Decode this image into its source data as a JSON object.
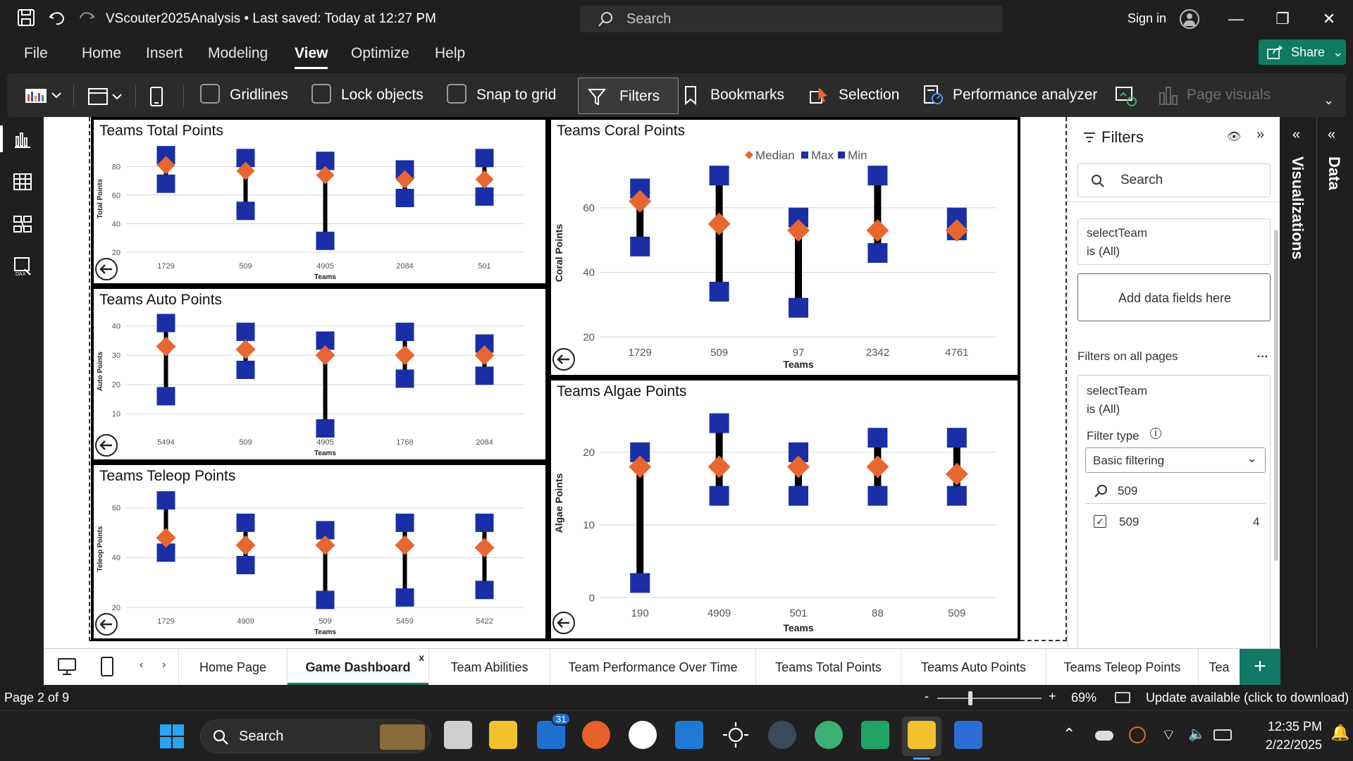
{
  "titlebar": {
    "doc_title": "VScouter2025Analysis • Last saved: Today at 12:27 PM",
    "search_placeholder": "Search",
    "sign_in": "Sign in"
  },
  "menu": {
    "items": [
      "File",
      "Home",
      "Insert",
      "Modeling",
      "View",
      "Optimize",
      "Help"
    ],
    "active": "View",
    "share": "Share"
  },
  "ribbon": {
    "gridlines": "Gridlines",
    "lock_objects": "Lock objects",
    "snap_to_grid": "Snap to grid",
    "filters": "Filters",
    "bookmarks": "Bookmarks",
    "selection": "Selection",
    "performance_analyzer": "Performance analyzer",
    "page_visuals": "Page visuals"
  },
  "colors": {
    "median": "#e8662f",
    "maxmin": "#1a2fa6",
    "bar": "#000000",
    "accent": "#117865"
  },
  "chart_data": [
    {
      "type": "scatter",
      "title": "Teams Total Points",
      "xlabel": "Teams",
      "ylabel": "Total Points",
      "categories": [
        "1729",
        "509",
        "4905",
        "2084",
        "501"
      ],
      "ylim": [
        20,
        95
      ],
      "yticks": [
        20,
        40,
        60,
        80
      ],
      "series": [
        {
          "name": "Median",
          "values": [
            81,
            77,
            74,
            71,
            71
          ]
        },
        {
          "name": "Max",
          "values": [
            88,
            86,
            84,
            78,
            86
          ]
        },
        {
          "name": "Min",
          "values": [
            68,
            49,
            28,
            58,
            59
          ]
        }
      ]
    },
    {
      "type": "scatter",
      "title": "Teams Auto Points",
      "xlabel": "Teams",
      "ylabel": "Auto Points",
      "categories": [
        "5494",
        "509",
        "4905",
        "1768",
        "2084"
      ],
      "ylim": [
        5,
        44
      ],
      "yticks": [
        10,
        20,
        30,
        40
      ],
      "series": [
        {
          "name": "Median",
          "values": [
            33,
            32,
            30,
            30,
            30
          ]
        },
        {
          "name": "Max",
          "values": [
            41,
            38,
            35,
            38,
            34
          ]
        },
        {
          "name": "Min",
          "values": [
            16,
            25,
            5,
            22,
            23
          ]
        }
      ]
    },
    {
      "type": "scatter",
      "title": "Teams Teleop Points",
      "xlabel": "Teams",
      "ylabel": "Teleop Points",
      "categories": [
        "1729",
        "4909",
        "509",
        "5459",
        "5422"
      ],
      "ylim": [
        20,
        67
      ],
      "yticks": [
        20,
        40,
        60
      ],
      "series": [
        {
          "name": "Median",
          "values": [
            48,
            45,
            45,
            45,
            44
          ]
        },
        {
          "name": "Max",
          "values": [
            63,
            54,
            51,
            54,
            54
          ]
        },
        {
          "name": "Min",
          "values": [
            42,
            37,
            23,
            24,
            27
          ]
        }
      ]
    },
    {
      "type": "scatter",
      "title": "Teams Coral Points",
      "xlabel": "Teams",
      "ylabel": "Coral Points",
      "legend": [
        "Median",
        "Max",
        "Min"
      ],
      "legend_position": "top-center",
      "categories": [
        "1729",
        "509",
        "97",
        "2342",
        "4761"
      ],
      "ylim": [
        20,
        72
      ],
      "yticks": [
        20,
        40,
        60
      ],
      "series": [
        {
          "name": "Median",
          "values": [
            62,
            55,
            53,
            53,
            53
          ]
        },
        {
          "name": "Max",
          "values": [
            66,
            70,
            57,
            70,
            57
          ]
        },
        {
          "name": "Min",
          "values": [
            48,
            34,
            29,
            46,
            53
          ]
        }
      ]
    },
    {
      "type": "scatter",
      "title": "Teams Algae Points",
      "xlabel": "Teams",
      "ylabel": "Algae Points",
      "categories": [
        "190",
        "4909",
        "501",
        "88",
        "509"
      ],
      "ylim": [
        0,
        26
      ],
      "yticks": [
        0,
        10,
        20
      ],
      "series": [
        {
          "name": "Median",
          "values": [
            18,
            18,
            18,
            18,
            17
          ]
        },
        {
          "name": "Max",
          "values": [
            20,
            24,
            20,
            22,
            22
          ]
        },
        {
          "name": "Min",
          "values": [
            2,
            14,
            14,
            14,
            14
          ]
        }
      ]
    }
  ],
  "filters": {
    "title": "Filters",
    "search_placeholder": "Search",
    "visual_filter_name": "selectTeam",
    "visual_filter_state": "is (All)",
    "add_data_fields": "Add data fields here",
    "on_all_pages": "Filters on all pages",
    "page_filter_name": "selectTeam",
    "page_filter_state": "is (All)",
    "filter_type_label": "Filter type",
    "filter_type_value": "Basic filtering",
    "search_value": "509",
    "option_label": "509",
    "option_count": "4"
  },
  "side_panes": {
    "visualizations": "Visualizations",
    "data": "Data"
  },
  "pages": {
    "tabs": [
      "Home Page",
      "Game Dashboard",
      "Team Abilities",
      "Team Performance Over Time",
      "Teams Total Points",
      "Teams Auto Points",
      "Teams Teleop Points",
      "Tea"
    ],
    "active": "Game Dashboard",
    "close": "x"
  },
  "status": {
    "page": "Page 2 of 9",
    "zoom_minus": "-",
    "zoom_plus": "+",
    "zoom": "69%",
    "update": "Update available (click to download)"
  },
  "taskbar": {
    "search": "Search",
    "badge": "31",
    "time": "12:35 PM",
    "date": "2/22/2025"
  }
}
